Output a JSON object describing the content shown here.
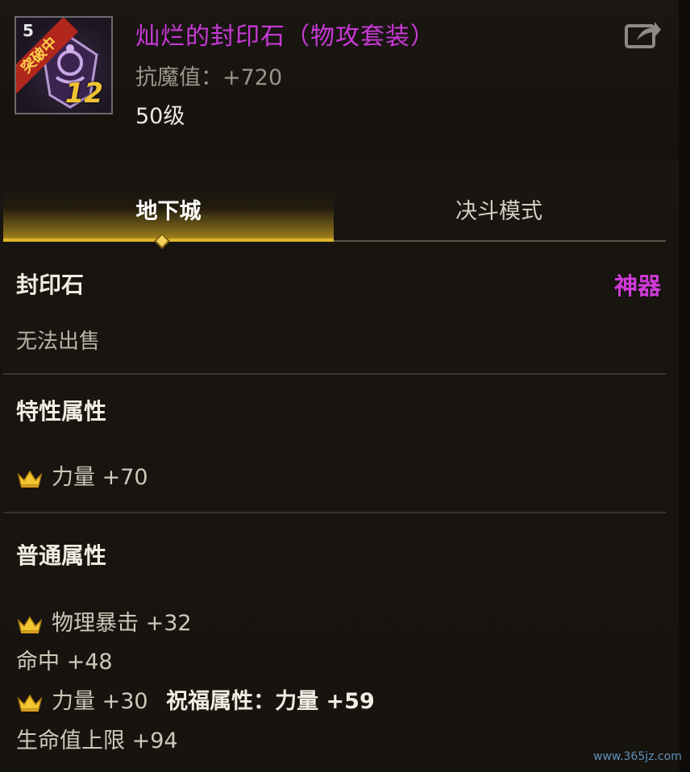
{
  "item": {
    "name": "灿烂的封印石（物攻套装）",
    "stat": "抗魔值：+720",
    "level": "50级",
    "icon": {
      "level_tag": "5",
      "ribbon": "突破中",
      "number": "12"
    }
  },
  "tabs": [
    {
      "label": "地下城",
      "active": true
    },
    {
      "label": "决斗模式",
      "active": false
    }
  ],
  "info": {
    "type": "封印石",
    "rarity": "神器",
    "rarity_color": "#d13ad8",
    "sell": "无法出售"
  },
  "special": {
    "title": "特性属性",
    "attrs": [
      "力量 +70"
    ]
  },
  "common": {
    "title": "普通属性",
    "line1": "物理暴击 +32",
    "line2": "命中 +48",
    "line3_main": "力量 +30",
    "line3_bless": "祝福属性：力量 +59",
    "line4": "生命值上限 +94"
  },
  "watermark": "www.365jz.com"
}
